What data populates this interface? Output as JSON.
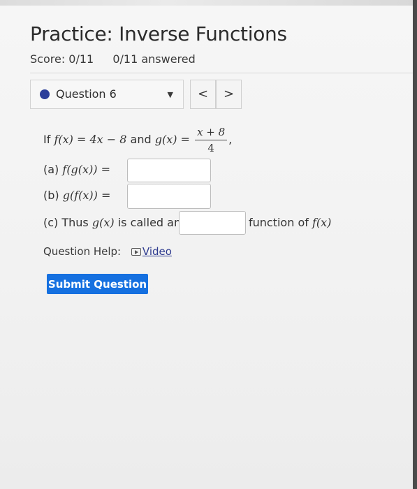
{
  "header": {
    "title": "Practice: Inverse Functions",
    "score": "Score: 0/11",
    "answered": "0/11 answered"
  },
  "question_nav": {
    "label": "Question 6",
    "prev_label": "<",
    "next_label": ">"
  },
  "problem": {
    "intro": "If",
    "f_def": "f(x) = 4x − 8",
    "and": "and",
    "g_lhs": "g(x) =",
    "g_num": "x + 8",
    "g_den": "4",
    "comma": ",",
    "part_a_prefix": "(a)",
    "part_a_expr": "f(g(x)) =",
    "part_b_prefix": "(b)",
    "part_b_expr": "g(f(x)) =",
    "part_c_prefix": "(c) Thus",
    "part_c_g": "g(x)",
    "part_c_mid": "is called an",
    "part_c_suffix": "function of",
    "part_c_f": "f(x)"
  },
  "inputs": {
    "answer_a": "",
    "answer_b": "",
    "answer_c": ""
  },
  "help": {
    "label": "Question Help:",
    "video_label": "Video"
  },
  "actions": {
    "submit_label": "Submit Question"
  },
  "colors": {
    "accent": "#1570e0",
    "status_dot": "#2c3e9a"
  }
}
